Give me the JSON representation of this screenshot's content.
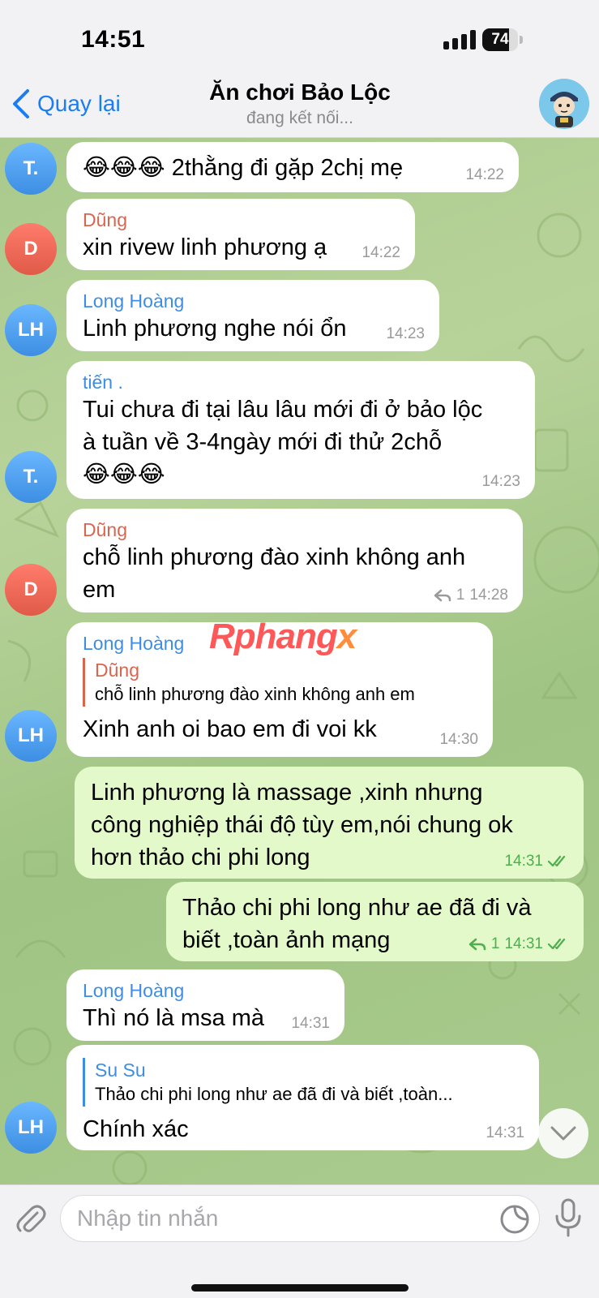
{
  "status_bar": {
    "time": "14:51",
    "battery_level": "74",
    "battery_fraction": 0.74
  },
  "header": {
    "back_label": "Quay lại",
    "title": "Ăn chơi Bảo Lộc",
    "status": "đang kết nối...",
    "accent_color": "#1a7df0"
  },
  "messages": [
    {
      "avatar": "T.",
      "text": "😂😂😂 2thằng đi gặp 2chị mẹ",
      "time": "14:22"
    },
    {
      "avatar": "D",
      "sender": "Dũng",
      "text": "xin rivew linh phương ạ",
      "time": "14:22"
    },
    {
      "avatar": "LH",
      "sender": "Long Hoàng",
      "text": "Linh phương nghe nói ổn",
      "time": "14:23"
    },
    {
      "avatar": "T.",
      "sender": "tiến .",
      "lines": [
        "Tui chưa đi tại lâu lâu mới đi ở bảo lộc",
        "à tuần về 3-4ngày mới đi thử 2chỗ",
        "😂😂😂"
      ],
      "time": "14:23"
    },
    {
      "avatar": "D",
      "sender": "Dũng",
      "lines": [
        "chỗ linh phương đào xinh không anh",
        "em"
      ],
      "replies": "1",
      "time": "14:28"
    },
    {
      "avatar": "LH",
      "sender": "Long Hoàng",
      "quote_name": "Dũng",
      "quote_text": "chỗ linh phương đào xinh không anh em",
      "text": "Xinh anh oi bao em đi voi kk",
      "time": "14:30"
    },
    {
      "outgoing": true,
      "lines": [
        "Linh phương là massage ,xinh nhưng",
        "công nghiệp thái độ tùy em,nói chung ok",
        "hơn thảo chi phi long"
      ],
      "time": "14:31"
    },
    {
      "outgoing": true,
      "lines": [
        "Thảo chi phi long như ae đã đi và",
        "biết ,toàn ảnh mạng"
      ],
      "replies": "1",
      "time": "14:31"
    },
    {
      "sender": "Long Hoàng",
      "text": "Thì nó là msa mà",
      "time": "14:31"
    },
    {
      "avatar": "LH",
      "quote_name": "Su Su",
      "quote_text": "Thảo chi phi long như ae đã đi và biết ,toàn...",
      "text": "Chính xác",
      "time": "14:31"
    }
  ],
  "watermark": {
    "main": "Rphang",
    "tail": "x"
  },
  "input": {
    "placeholder": "Nhập tin nhắn"
  },
  "colors": {
    "name_red": "#d9654f",
    "name_blue": "#3d8ee3",
    "outgoing_bubble": "#e3f9c9",
    "checkmarks": "#4fae4e"
  }
}
